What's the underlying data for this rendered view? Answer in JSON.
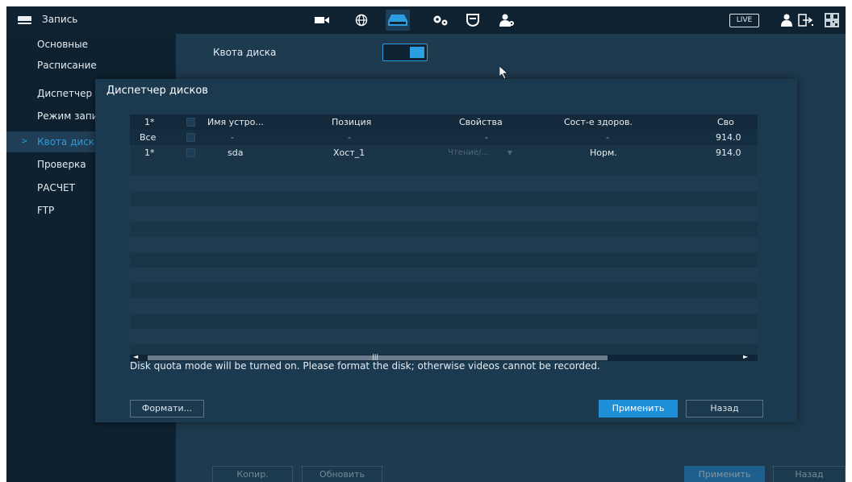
{
  "topbar": {
    "title": "Запись",
    "live_label": "LIVE",
    "icons": [
      "camera-icon",
      "network-icon",
      "storage-icon",
      "settings-icon",
      "shield-icon",
      "account-icon"
    ]
  },
  "sidebar": {
    "items": [
      {
        "label": "Основные"
      },
      {
        "label": "Расписание"
      },
      {
        "label": "Диспетчер"
      },
      {
        "label": "Режим записи"
      },
      {
        "label": "Квота диска",
        "active": true
      },
      {
        "label": "Проверка"
      },
      {
        "label": "РАСЧЕТ"
      },
      {
        "label": "FTP"
      }
    ]
  },
  "main": {
    "quota_label": "Квота диска",
    "quota_enabled": true
  },
  "dialog": {
    "title": "Диспетчер дисков",
    "columns": [
      "1*",
      "",
      "Имя устро...",
      "Позиция",
      "Свойства",
      "Сост-е здоров.",
      "Сво"
    ],
    "rows": [
      {
        "num": "Все",
        "name": "-",
        "position": "-",
        "properties": "-",
        "health": "-",
        "free": "914.0"
      },
      {
        "num": "1*",
        "name": "sda",
        "position": "Хост_1",
        "properties": "Чтение/...",
        "health": "Норм.",
        "free": "914.0"
      }
    ],
    "notice": "Disk quota mode will be turned on. Please format the disk; otherwise videos cannot be recorded.",
    "format_button": "Формати...",
    "apply_button": "Применить",
    "back_button": "Назад"
  },
  "bottom": {
    "copy_button": "Копир.",
    "refresh_button": "Обновить",
    "apply_button": "Применить",
    "back_button": "Назад"
  },
  "colors": {
    "accent": "#2c9de0",
    "background": "#1e3a4e",
    "sidebar": "#0d2130",
    "primary_button": "#1f8fda"
  }
}
